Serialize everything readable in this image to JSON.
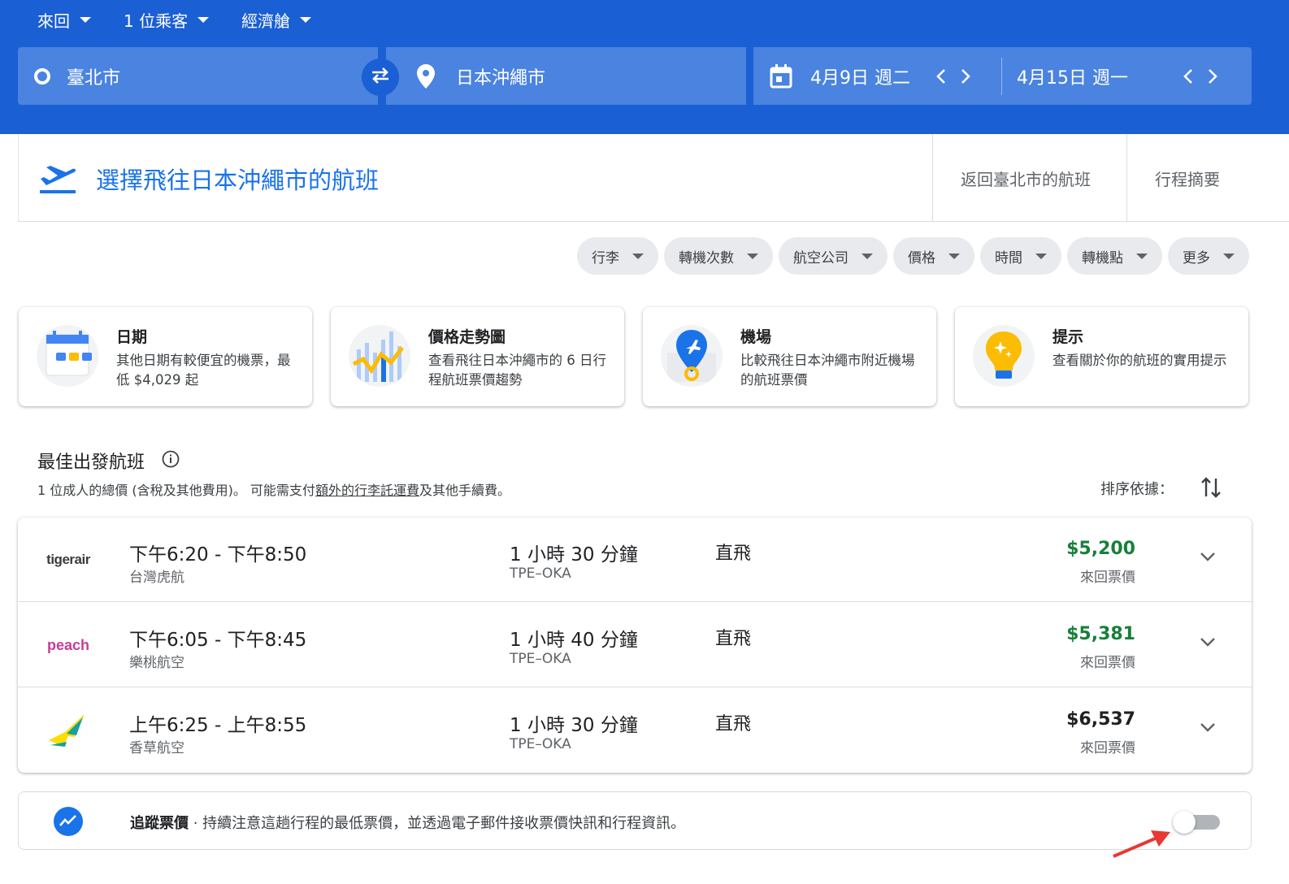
{
  "search": {
    "trip_type": "來回",
    "passengers": "1 位乘客",
    "cabin": "經濟艙",
    "origin": "臺北市",
    "destination": "日本沖繩市",
    "depart_date": "4月9日 週二",
    "return_date": "4月15日 週一"
  },
  "heading": {
    "title": "選擇飛往日本沖繩市的航班",
    "step_return": "返回臺北市的航班",
    "step_summary": "行程摘要"
  },
  "filters": [
    "行李",
    "轉機次數",
    "航空公司",
    "價格",
    "時間",
    "轉機點",
    "更多"
  ],
  "cards": [
    {
      "title": "日期",
      "desc": "其他日期有較便宜的機票，最低 $4,029 起"
    },
    {
      "title": "價格走勢圖",
      "desc": "查看飛往日本沖繩市的 6 日行程航班票價趨勢"
    },
    {
      "title": "機場",
      "desc": "比較飛往日本沖繩市附近機場的航班票價"
    },
    {
      "title": "提示",
      "desc": "查看關於你的航班的實用提示"
    }
  ],
  "section": {
    "title": "最佳出發航班",
    "sub_prefix": "1 位成人的總價 (含稅及其他費用)。 可能需支付",
    "sub_link": "額外的行李託運費",
    "sub_suffix": "及其他手續費。",
    "sort_label": "排序依據："
  },
  "flights": [
    {
      "logo_text": "tigerair",
      "times": "下午6:20 - 下午8:50",
      "airline": "台灣虎航",
      "duration": "1 小時 30 分鐘",
      "route": "TPE–OKA",
      "stops": "直飛",
      "price": "$5,200",
      "price_type": "來回票價",
      "price_color": "#188038"
    },
    {
      "logo_text": "peach",
      "times": "下午6:05 - 下午8:45",
      "airline": "樂桃航空",
      "duration": "1 小時 40 分鐘",
      "route": "TPE–OKA",
      "stops": "直飛",
      "price": "$5,381",
      "price_type": "來回票價",
      "price_color": "#188038"
    },
    {
      "logo_text": "",
      "times": "上午6:25 - 上午8:55",
      "airline": "香草航空",
      "duration": "1 小時 30 分鐘",
      "route": "TPE–OKA",
      "stops": "直飛",
      "price": "$6,537",
      "price_type": "來回票價",
      "price_color": "#202124"
    }
  ],
  "tracking": {
    "label": "追蹤票價",
    "text": " · 持續注意這趟行程的最低票價，並透過電子郵件接收票價快訊和行程資訊。",
    "enabled": false
  },
  "colors": {
    "header_blue": "#1a5fd4",
    "field_blue": "#4a83e0",
    "link_blue": "#1a73e8",
    "price_green": "#188038",
    "annotation_red": "#e53935"
  }
}
